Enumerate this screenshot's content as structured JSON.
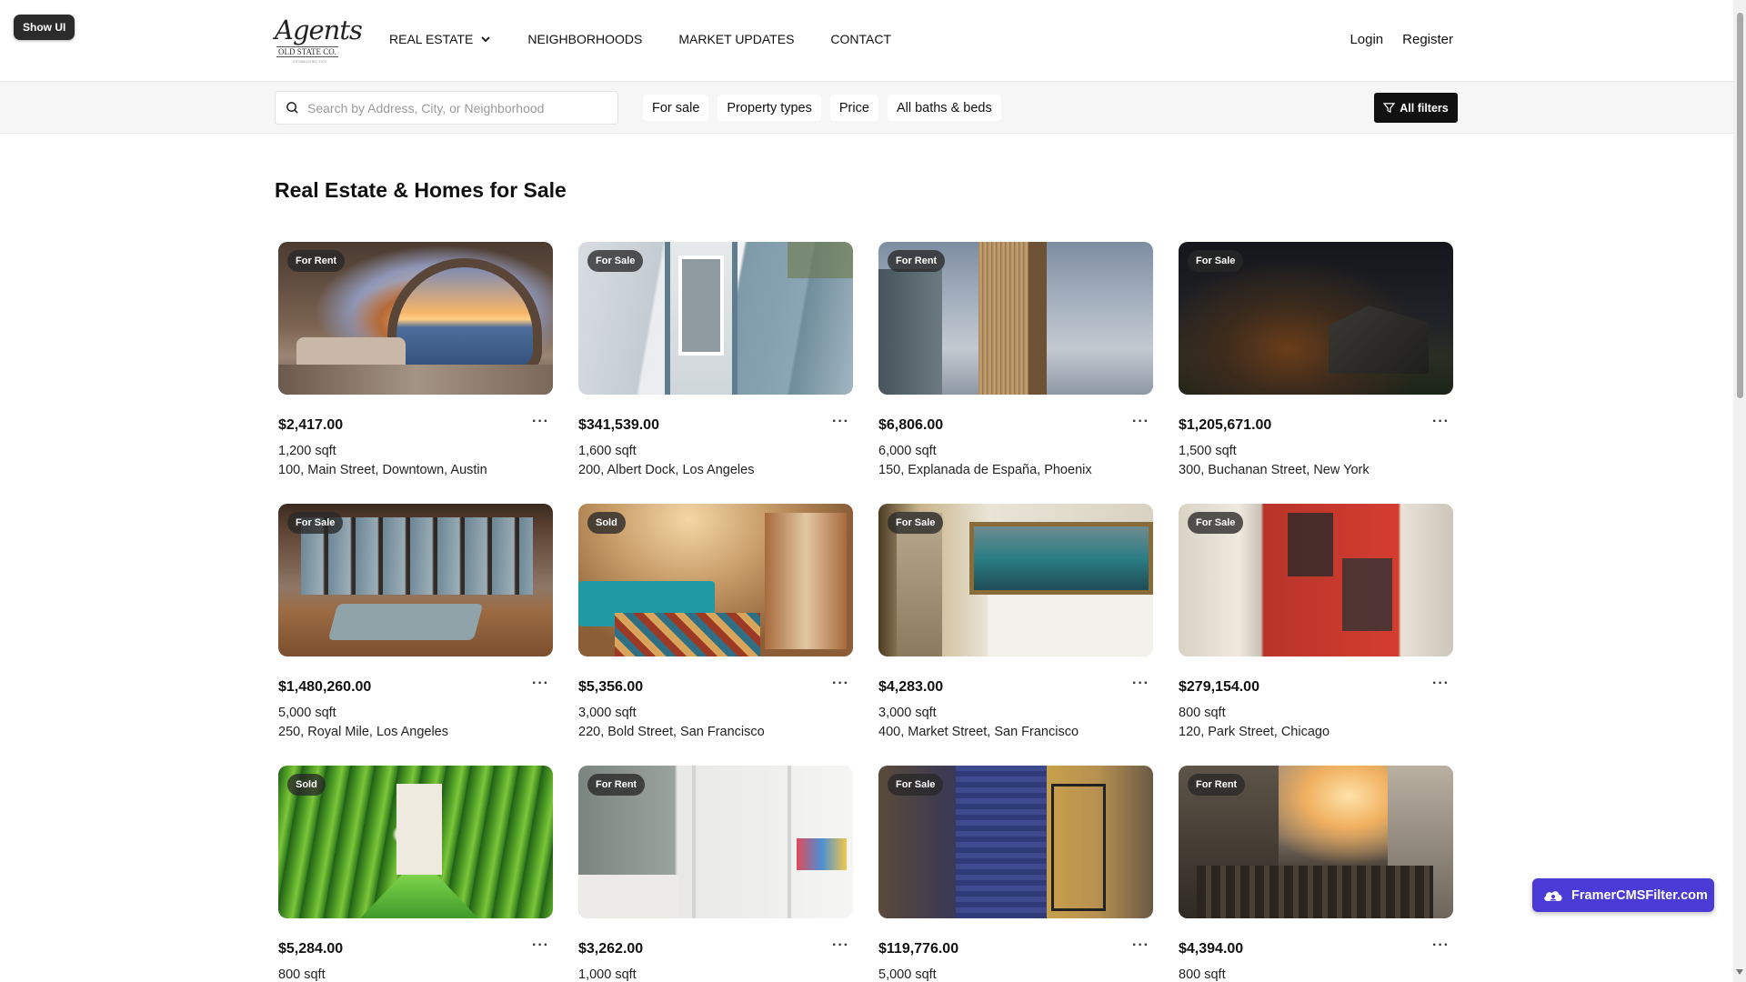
{
  "overlay": {
    "show_ui_label": "Show UI"
  },
  "header": {
    "logo": {
      "script": "Agents",
      "sub": "OLD STATE CO.",
      "tiny": "ESTABLISHED 1972"
    },
    "nav": [
      {
        "label": "REAL ESTATE",
        "has_dropdown": true
      },
      {
        "label": "NEIGHBORHOODS"
      },
      {
        "label": "MARKET UPDATES"
      },
      {
        "label": "CONTACT"
      }
    ],
    "login_label": "Login",
    "register_label": "Register"
  },
  "filters": {
    "search_placeholder": "Search by Address, City, or Neighborhood",
    "chips": [
      "For sale",
      "Property types",
      "Price",
      "All baths & beds"
    ],
    "all_filters_label": "All filters"
  },
  "page_title": "Real Estate & Homes for Sale",
  "listings": [
    {
      "badge": "For Rent",
      "price": "$2,417.00",
      "sqft": "1,200 sqft",
      "address": "100, Main Street, Downtown, Austin",
      "image": "ocean-sunset-bedroom"
    },
    {
      "badge": "For Sale",
      "price": "$341,539.00",
      "sqft": "1,600 sqft",
      "address": "200, Albert Dock, Los Angeles",
      "image": "blue-victorian-facade"
    },
    {
      "badge": "For Rent",
      "price": "$6,806.00",
      "sqft": "6,000 sqft",
      "address": "150, Explanada de España, Phoenix",
      "image": "skyscraper-cloudy-sky"
    },
    {
      "badge": "For Sale",
      "price": "$1,205,671.00",
      "sqft": "1,500 sqft",
      "address": "300, Buchanan Street, New York",
      "image": "dark-barn-field"
    },
    {
      "badge": "For Sale",
      "price": "$1,480,260.00",
      "sqft": "5,000 sqft",
      "address": "250, Royal Mile, Los Angeles",
      "image": "loft-living-room"
    },
    {
      "badge": "Sold",
      "price": "$5,356.00",
      "sqft": "3,000 sqft",
      "address": "220, Bold Street, San Francisco",
      "image": "teal-hotel-room"
    },
    {
      "badge": "For Sale",
      "price": "$4,283.00",
      "sqft": "3,000 sqft",
      "address": "400, Market Street, San Francisco",
      "image": "modern-bedroom"
    },
    {
      "badge": "For Sale",
      "price": "$279,154.00",
      "sqft": "800 sqft",
      "address": "120, Park Street, Chicago",
      "image": "red-door"
    },
    {
      "badge": "Sold",
      "price": "$5,284.00",
      "sqft": "800 sqft",
      "address": "",
      "image": "green-vine-tunnel"
    },
    {
      "badge": "For Rent",
      "price": "$3,262.00",
      "sqft": "1,000 sqft",
      "address": "",
      "image": "white-kids-room"
    },
    {
      "badge": "For Sale",
      "price": "$119,776.00",
      "sqft": "5,000 sqft",
      "address": "",
      "image": "tiled-building-balconies"
    },
    {
      "badge": "For Rent",
      "price": "$4,394.00",
      "sqft": "800 sqft",
      "address": "",
      "image": "busy-city-street"
    }
  ],
  "more_label": "···",
  "framer_badge": {
    "label": "FramerCMSFilter.com"
  }
}
